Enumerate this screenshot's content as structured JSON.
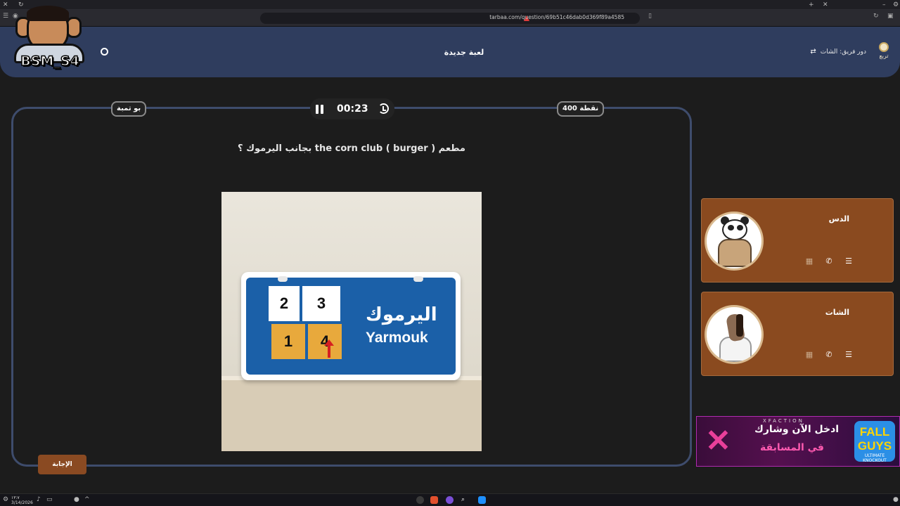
{
  "browser": {
    "url": "tarbaa.com/question/69b51c46dab0d369f89a4585"
  },
  "header": {
    "title": "لعبة جديدة",
    "turn_label": "دور فريق: الشات",
    "logo_text": "تربع"
  },
  "streamer": {
    "name": "BSM_S4"
  },
  "question": {
    "team_badge": "بو تمبة",
    "points_badge": "400 نقطة",
    "timer": "00:23",
    "text": "مطعم ( burger ) the corn club بجانب اليرموك ؟",
    "answer_button": "الإجابة"
  },
  "image": {
    "plate_ar": "اليرموك",
    "plate_en": "Yarmouk",
    "tiles": [
      "2",
      "3",
      "1",
      "4"
    ]
  },
  "teams": [
    {
      "name": "الدس",
      "avatar": "panda-icon"
    },
    {
      "name": "الشات",
      "avatar": "horse-icon"
    }
  ],
  "promo": {
    "brand": "XFACTION",
    "line1": "ادخل الآن وشارك",
    "line2": "في المسابقة",
    "logo1": "FALL GUYS",
    "logo2": "ULTIMATE KNOCKOUT"
  },
  "taskbar": {
    "time": "١٣:٧",
    "date": "3/14/2026"
  },
  "colors": {
    "header": "#2f3d5e",
    "team_card": "#8a4a1f",
    "answer_button": "#8a4a22",
    "plate_blue": "#1b60a8",
    "tile_yellow": "#e8a93c"
  }
}
